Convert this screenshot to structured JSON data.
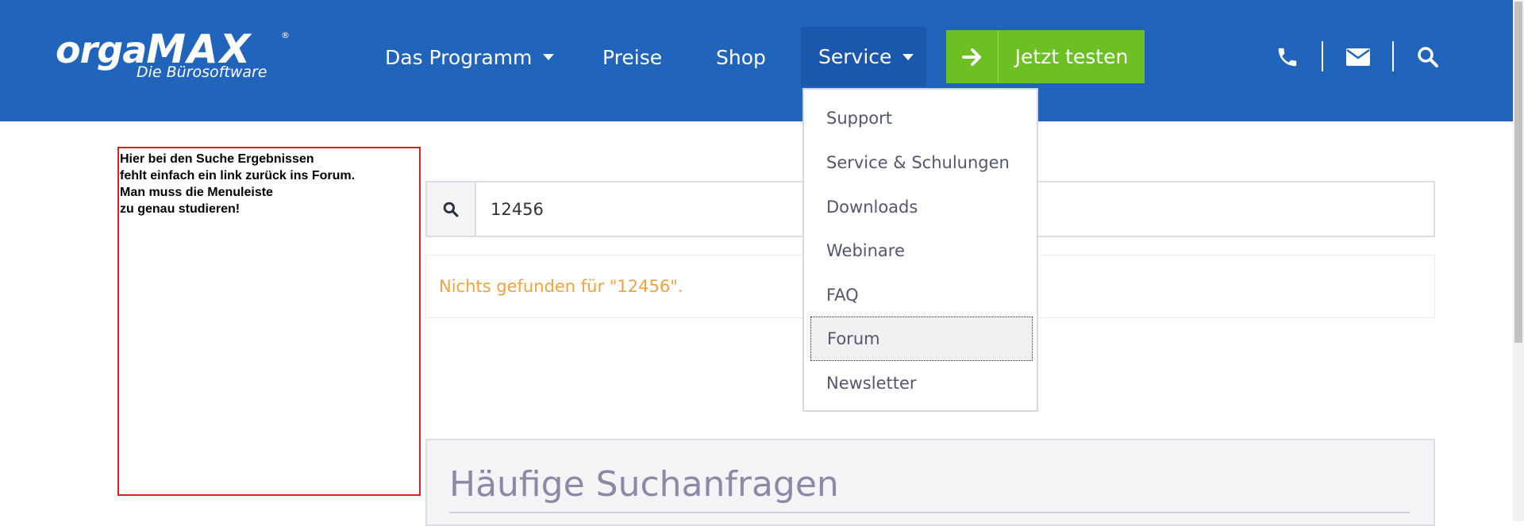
{
  "header": {
    "logo": {
      "brand_left": "orga",
      "brand_right": "MAX",
      "registered": "®",
      "tagline": "Die Bürosoftware"
    },
    "nav": [
      {
        "label": "Das Programm",
        "has_dropdown": true
      },
      {
        "label": "Preise",
        "has_dropdown": false
      },
      {
        "label": "Shop",
        "has_dropdown": false
      },
      {
        "label": "Service",
        "has_dropdown": true,
        "active": true
      }
    ],
    "cta": {
      "label": "Jetzt testen",
      "icon": "arrow-right-icon"
    },
    "icons": [
      "phone-icon",
      "mail-icon",
      "search-icon"
    ],
    "colors": {
      "background": "#2164bb",
      "active_nav": "#1b58ad",
      "cta": "#6cc024"
    }
  },
  "annotation": {
    "lines": [
      "Hier bei den Suche Ergebnissen",
      "fehlt einfach ein link zurück ins Forum.",
      "Man muss die Menuleiste",
      "zu genau studieren!"
    ],
    "border_color": "#e02020"
  },
  "search": {
    "value": "12456",
    "icon": "search-icon"
  },
  "result": {
    "message": "Nichts gefunden für \"12456\".",
    "color": "#f3a23b"
  },
  "faq_section": {
    "title": "Häufige Suchanfragen"
  },
  "dropdown": {
    "items": [
      {
        "label": "Support"
      },
      {
        "label": "Service & Schulungen"
      },
      {
        "label": "Downloads"
      },
      {
        "label": "Webinare"
      },
      {
        "label": "FAQ"
      },
      {
        "label": "Forum",
        "focused": true
      },
      {
        "label": "Newsletter"
      }
    ]
  }
}
